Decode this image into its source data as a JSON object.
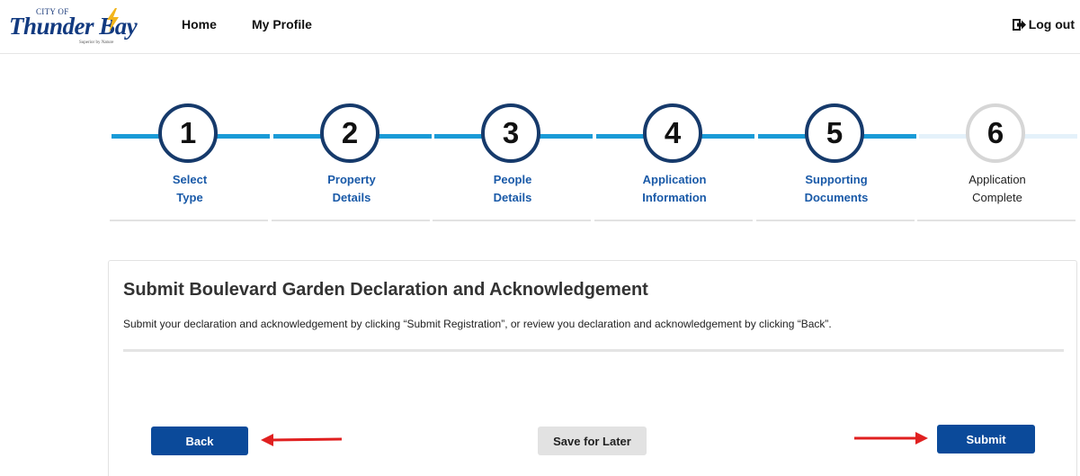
{
  "header": {
    "logo_small": "CITY OF",
    "logo_big": "Thunder Bay",
    "logo_tagline": "Superior by Nature",
    "nav": {
      "home": "Home",
      "profile": "My Profile"
    },
    "logout": "Log out"
  },
  "stepper": {
    "steps": [
      {
        "number": "1",
        "line1": "Select",
        "line2": "Type",
        "status": "done"
      },
      {
        "number": "2",
        "line1": "Property",
        "line2": "Details",
        "status": "done"
      },
      {
        "number": "3",
        "line1": "People",
        "line2": "Details",
        "status": "done"
      },
      {
        "number": "4",
        "line1": "Application",
        "line2": "Information",
        "status": "done"
      },
      {
        "number": "5",
        "line1": "Supporting",
        "line2": "Documents",
        "status": "done"
      },
      {
        "number": "6",
        "line1": "Application",
        "line2": "Complete",
        "status": "pending"
      }
    ]
  },
  "panel": {
    "title": "Submit Boulevard Garden Declaration and Acknowledgement",
    "description": "Submit your declaration and acknowledgement by clicking “Submit Registration”, or review you declaration and acknowledgement by clicking “Back”."
  },
  "buttons": {
    "back": "Back",
    "save_later": "Save for Later",
    "submit": "Submit"
  },
  "colors": {
    "primary": "#0b4a9a",
    "step_line": "#1a9bd7",
    "step_circle": "#163a6b",
    "arrow": "#e02020"
  }
}
